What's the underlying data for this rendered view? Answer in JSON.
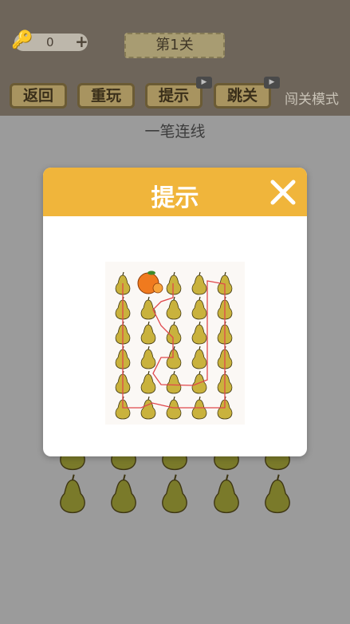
{
  "header": {
    "key_count": "0",
    "level_title": "第1关"
  },
  "buttons": {
    "back": "返回",
    "replay": "重玩",
    "hint": "提示",
    "skip": "跳关"
  },
  "mode_label": "闯关模式",
  "subtitle": "一笔连线",
  "modal": {
    "title": "提示"
  },
  "colors": {
    "modal_header": "#f0b53b",
    "pear": "#c9b23d",
    "path_line": "#e0474c",
    "orange": "#f07a1e"
  },
  "icons": {
    "key": "key-icon",
    "plus": "plus-icon",
    "video": "video-camera-icon",
    "close": "close-icon",
    "pear": "pear-icon",
    "orange": "orange-icon"
  }
}
